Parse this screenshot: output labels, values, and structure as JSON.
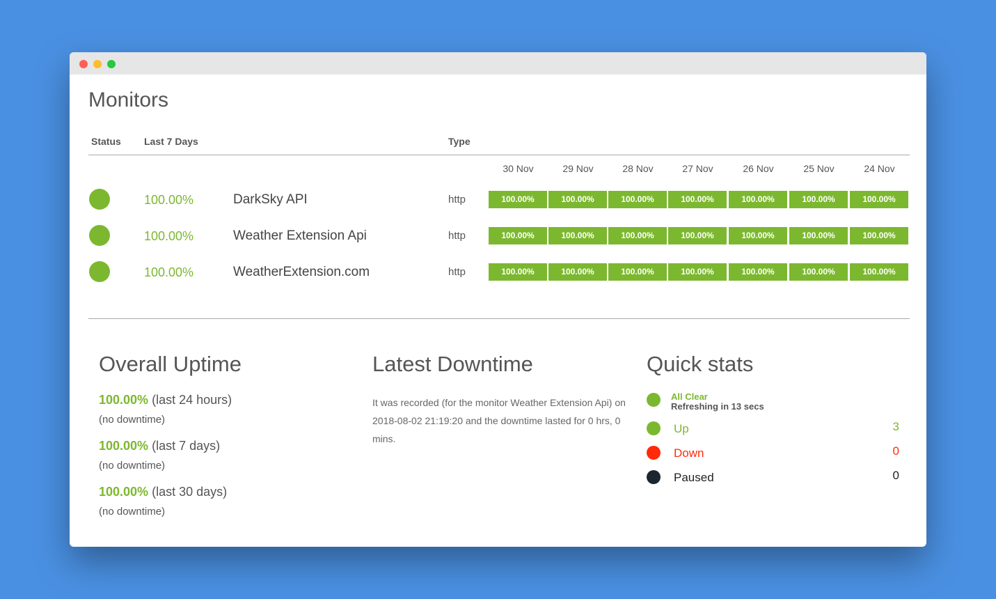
{
  "page_title": "Monitors",
  "table": {
    "headers": {
      "status": "Status",
      "last7": "Last 7 Days",
      "type": "Type"
    },
    "dates": [
      "30 Nov",
      "29 Nov",
      "28 Nov",
      "27 Nov",
      "26 Nov",
      "25 Nov",
      "24 Nov"
    ],
    "rows": [
      {
        "uptime": "100.00%",
        "name": "DarkSky API",
        "type": "http",
        "days": [
          "100.00%",
          "100.00%",
          "100.00%",
          "100.00%",
          "100.00%",
          "100.00%",
          "100.00%"
        ]
      },
      {
        "uptime": "100.00%",
        "name": "Weather Extension Api",
        "type": "http",
        "days": [
          "100.00%",
          "100.00%",
          "100.00%",
          "100.00%",
          "100.00%",
          "100.00%",
          "100.00%"
        ]
      },
      {
        "uptime": "100.00%",
        "name": "WeatherExtension.com",
        "type": "http",
        "days": [
          "100.00%",
          "100.00%",
          "100.00%",
          "100.00%",
          "100.00%",
          "100.00%",
          "100.00%"
        ]
      }
    ]
  },
  "overall_uptime": {
    "title": "Overall Uptime",
    "items": [
      {
        "pct": "100.00%",
        "period": "(last 24 hours)",
        "note": "(no downtime)"
      },
      {
        "pct": "100.00%",
        "period": "(last 7 days)",
        "note": "(no downtime)"
      },
      {
        "pct": "100.00%",
        "period": "(last 30 days)",
        "note": "(no downtime)"
      }
    ]
  },
  "latest_downtime": {
    "title": "Latest Downtime",
    "text": "It was recorded (for the monitor Weather Extension Api) on 2018-08-02 21:19:20 and the downtime lasted for 0 hrs, 0 mins."
  },
  "quick_stats": {
    "title": "Quick stats",
    "status_title": "All Clear",
    "status_sub": "Refreshing in 13 secs",
    "items": [
      {
        "label": "Up",
        "count": "3",
        "color": "#7cb82f"
      },
      {
        "label": "Down",
        "count": "0",
        "color": "#ff2a0a"
      },
      {
        "label": "Paused",
        "count": "0",
        "color": "#1b2631"
      }
    ]
  },
  "colors": {
    "accent_green": "#7cb82f",
    "background_blue": "#4a90e2"
  }
}
